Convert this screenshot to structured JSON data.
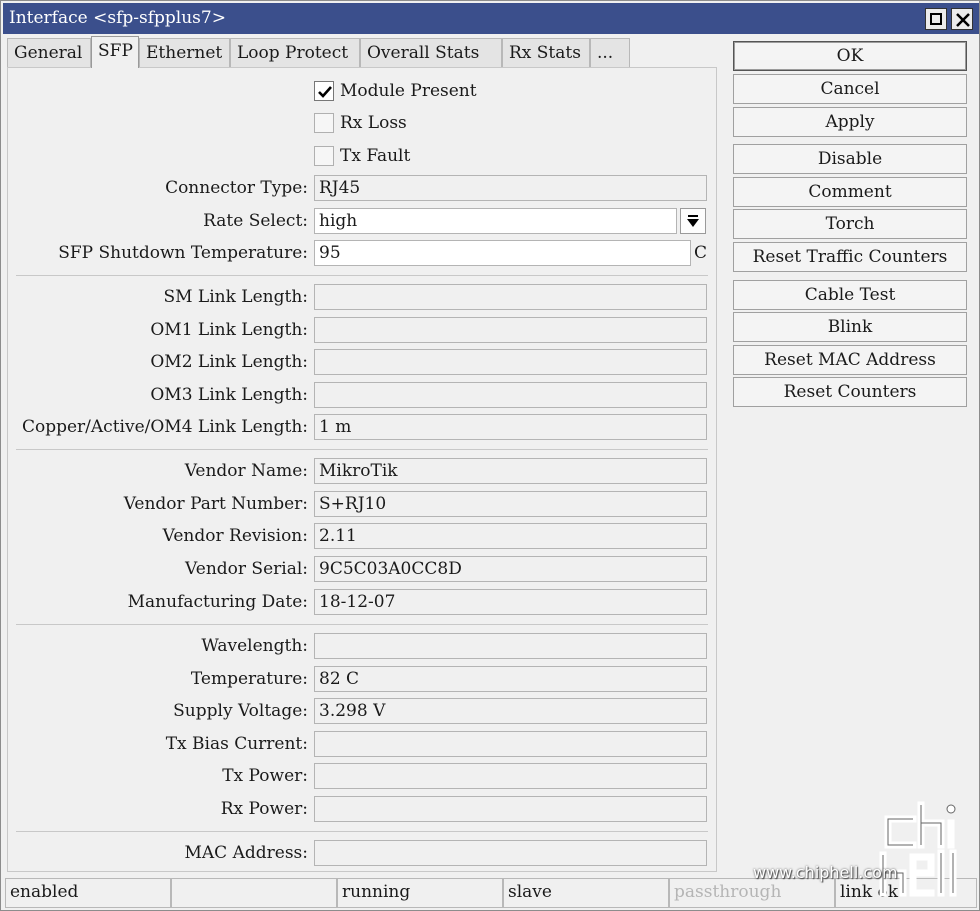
{
  "window": {
    "title": "Interface <sfp-sfpplus7>"
  },
  "tabs": [
    "General",
    "SFP",
    "Ethernet",
    "Loop Protect",
    "Overall Stats",
    "Rx Stats",
    "..."
  ],
  "checkboxes": {
    "module_present": {
      "label": "Module Present",
      "checked": true
    },
    "rx_loss": {
      "label": "Rx Loss",
      "checked": false
    },
    "tx_fault": {
      "label": "Tx Fault",
      "checked": false
    }
  },
  "fields": {
    "connector_type": {
      "label": "Connector Type:",
      "value": "RJ45"
    },
    "rate_select": {
      "label": "Rate Select:",
      "value": "high"
    },
    "shutdown_temp": {
      "label": "SFP Shutdown Temperature:",
      "value": "95",
      "unit": "C"
    },
    "sm_link": {
      "label": "SM Link Length:",
      "value": ""
    },
    "om1_link": {
      "label": "OM1 Link Length:",
      "value": ""
    },
    "om2_link": {
      "label": "OM2 Link Length:",
      "value": ""
    },
    "om3_link": {
      "label": "OM3 Link Length:",
      "value": ""
    },
    "copper_link": {
      "label": "Copper/Active/OM4 Link Length:",
      "value": "1 m"
    },
    "vendor_name": {
      "label": "Vendor Name:",
      "value": "MikroTik"
    },
    "vendor_part": {
      "label": "Vendor Part Number:",
      "value": "S+RJ10"
    },
    "vendor_rev": {
      "label": "Vendor Revision:",
      "value": "2.11"
    },
    "vendor_serial": {
      "label": "Vendor Serial:",
      "value": "9C5C03A0CC8D"
    },
    "mfg_date": {
      "label": "Manufacturing Date:",
      "value": "18-12-07"
    },
    "wavelength": {
      "label": "Wavelength:",
      "value": ""
    },
    "temperature": {
      "label": "Temperature:",
      "value": "82 C"
    },
    "supply_voltage": {
      "label": "Supply Voltage:",
      "value": "3.298 V"
    },
    "tx_bias": {
      "label": "Tx Bias Current:",
      "value": ""
    },
    "tx_power": {
      "label": "Tx Power:",
      "value": ""
    },
    "rx_power": {
      "label": "Rx Power:",
      "value": ""
    },
    "mac_address": {
      "label": "MAC Address:",
      "value": ""
    }
  },
  "buttons": [
    "OK",
    "Cancel",
    "Apply",
    "Disable",
    "Comment",
    "Torch",
    "Reset Traffic Counters",
    "Cable Test",
    "Blink",
    "Reset MAC Address",
    "Reset Counters"
  ],
  "status": [
    "enabled",
    "",
    "running",
    "slave",
    "passthrough",
    "link ok"
  ],
  "watermark": {
    "url": "www.chiphell.com",
    "logo_text": "chip hell"
  },
  "colors": {
    "titlebar": "#3b4f8c",
    "disabled_text": "#b5b5b5"
  },
  "icons": {
    "dropdown": "dropdown-arrow-icon",
    "maximize": "maximize-icon",
    "close": "close-icon",
    "check": "checkmark-icon"
  }
}
